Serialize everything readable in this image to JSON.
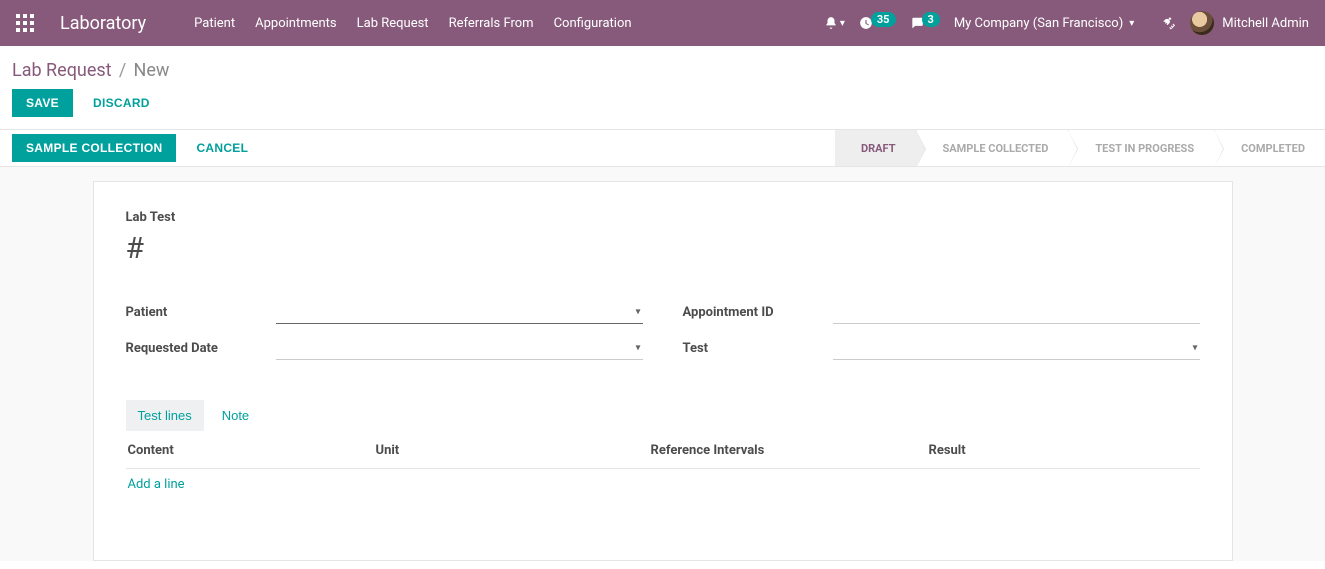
{
  "nav": {
    "brand": "Laboratory",
    "menu": [
      "Patient",
      "Appointments",
      "Lab Request",
      "Referrals From",
      "Configuration"
    ],
    "activities_count": "35",
    "messages_count": "3",
    "company": "My Company (San Francisco)",
    "user": "Mitchell Admin"
  },
  "breadcrumb": {
    "root": "Lab Request",
    "current": "New"
  },
  "actions": {
    "save": "SAVE",
    "discard": "DISCARD"
  },
  "statusbar": {
    "sample_collection": "SAMPLE COLLECTION",
    "cancel": "CANCEL",
    "stages": [
      "DRAFT",
      "SAMPLE COLLECTED",
      "TEST IN PROGRESS",
      "COMPLETED"
    ],
    "active_index": 0
  },
  "form": {
    "title_label": "Lab Test",
    "title_value": "#",
    "fields": {
      "patient": {
        "label": "Patient",
        "value": ""
      },
      "requested_date": {
        "label": "Requested Date",
        "value": ""
      },
      "appointment_id": {
        "label": "Appointment ID",
        "value": ""
      },
      "test": {
        "label": "Test",
        "value": ""
      }
    },
    "tabs": {
      "test_lines": "Test lines",
      "note": "Note"
    },
    "columns": {
      "content": "Content",
      "unit": "Unit",
      "reference_intervals": "Reference Intervals",
      "result": "Result"
    },
    "add_line": "Add a line"
  }
}
